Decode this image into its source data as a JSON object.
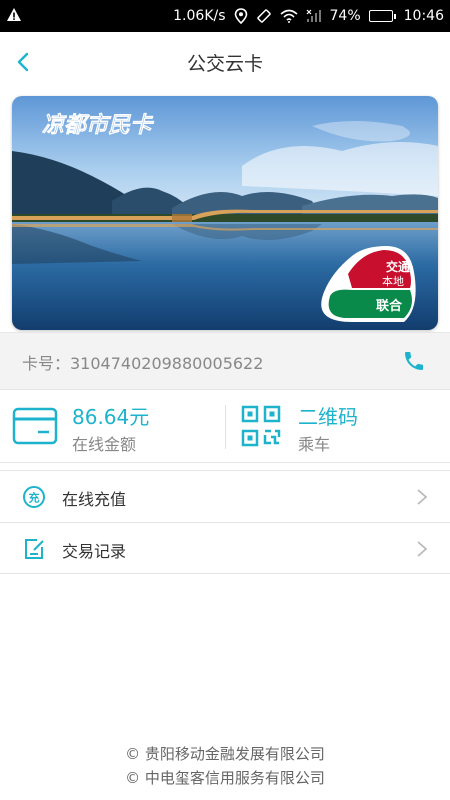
{
  "status_bar": {
    "speed": "1.06K/s",
    "battery": "74%",
    "battery_level": 0.74,
    "time": "10:46"
  },
  "header": {
    "title": "公交云卡",
    "back_icon": "chevron-left-icon"
  },
  "card": {
    "name": "凉都市民卡",
    "badge_line1": "交通",
    "badge_line2": "本地",
    "badge_union": "联合",
    "colors": {
      "sky": "#5e97d6",
      "water": "#1d4f86",
      "badge_red": "#c8102e",
      "badge_green": "#0a8a4a"
    }
  },
  "card_number": {
    "label": "卡号：3104740209880005622",
    "phone_icon": "phone-icon"
  },
  "balance": {
    "amount": "86.64元",
    "label": "在线金额",
    "icon": "card-icon"
  },
  "qrcode": {
    "title": "二维码",
    "label": "乘车",
    "icon": "qrcode-icon"
  },
  "menu": [
    {
      "label": "在线充值",
      "icon": "recharge-icon"
    },
    {
      "label": "交易记录",
      "icon": "record-icon"
    }
  ],
  "footer": {
    "line1": "© 贵阳移动金融发展有限公司",
    "line2": "© 中电玺客信用服务有限公司"
  },
  "accent": "#1eb3cc"
}
